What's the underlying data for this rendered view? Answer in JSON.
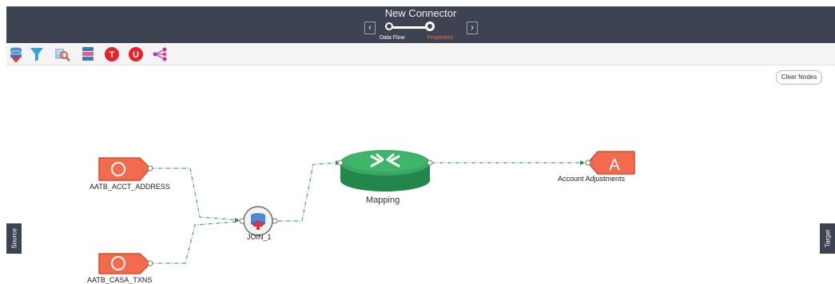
{
  "header": {
    "title": "New Connector",
    "prev_label": "‹",
    "next_label": "›",
    "steps": [
      {
        "label": "Data Flow"
      },
      {
        "label": "Properties"
      }
    ]
  },
  "toolbar": {
    "tools": [
      {
        "icon": "add-source-icon"
      },
      {
        "icon": "filter-icon"
      },
      {
        "icon": "lookup-icon"
      },
      {
        "icon": "aggregation-icon"
      },
      {
        "icon": "t-transform-icon",
        "text": "T"
      },
      {
        "icon": "u-union-icon",
        "text": "U"
      },
      {
        "icon": "split-icon"
      }
    ]
  },
  "actions": {
    "clear_label": "Clear Nodes"
  },
  "canvas": {
    "nodes": {
      "source1": {
        "letter": "O",
        "label": "AATB_ACCT_ADDRESS"
      },
      "source2": {
        "letter": "O",
        "label": "AATB_CASA_TXNS"
      },
      "join": {
        "label": "JOIN_1"
      },
      "mapping": {
        "label": "Mapping"
      },
      "target": {
        "letter": "A",
        "label": "Account Adjustments"
      }
    }
  },
  "side_tabs": {
    "source": "Source",
    "target": "Target"
  },
  "colors": {
    "header_bg": "#3d4351",
    "active_step": "#f0694a",
    "node_fill": "#f26b4f",
    "node_stroke": "#d84a2f",
    "link": "#2e8b57",
    "mapping_green": "#2e9a5a"
  }
}
